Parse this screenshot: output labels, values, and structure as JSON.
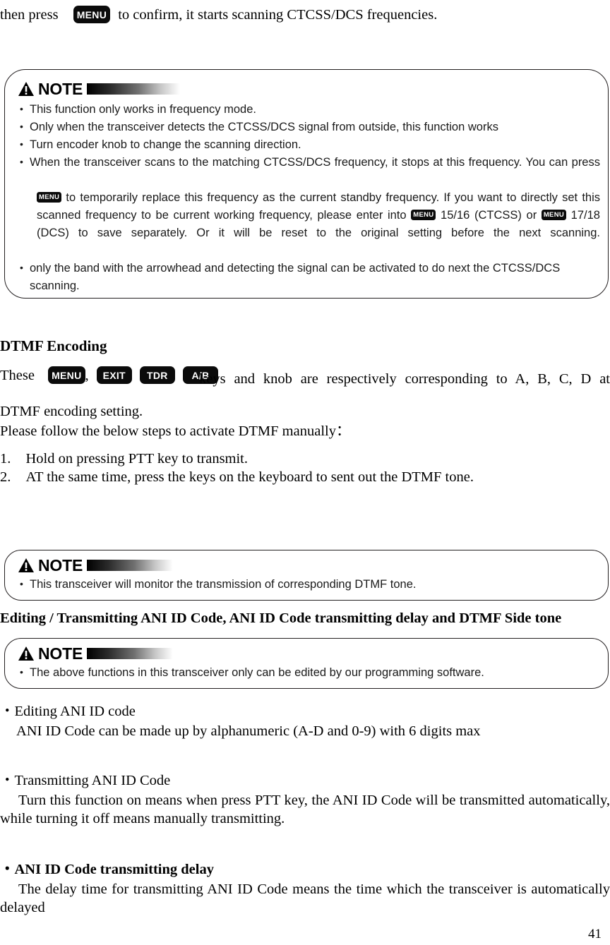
{
  "document": {
    "page_number": "41"
  },
  "intro": {
    "before_key": "then press",
    "key_label": "MENU",
    "after_key": "to confirm, it starts scanning CTCSS/DCS frequencies."
  },
  "note1": {
    "title": "NOTE",
    "icon": "warning-triangle-icon",
    "items": [
      "This function only works in frequency mode.",
      "Only when the transceiver detects the CTCSS/DCS signal from outside, this function works",
      "Turn encoder knob to change the scanning direction."
    ],
    "item4": {
      "part1": "When the transceiver scans to the matching CTCSS/DCS frequency, it stops at this frequency. You can press",
      "key1": "MENU",
      "part2": "to temporarily replace this frequency as the current standby frequency. If you want to directly set this scanned frequency to be current working frequency, please enter into",
      "key2": "MENU",
      "part3": "15/16 (CTCSS) or",
      "key3": "MENU",
      "part4": "17/18 (DCS) to save separately. Or it will be reset to the original setting before the next scanning."
    },
    "item5": "only the band with the arrowhead and detecting the signal can be activated to do next the CTCSS/DCS scanning."
  },
  "dtmf_encoding": {
    "heading": "DTMF Encoding",
    "line_start": "These",
    "keys": [
      "MENU",
      "EXIT",
      "TDR",
      "A/B"
    ],
    "key_separator": ",",
    "line_end": "keys and knob are respectively corresponding to A, B, C, D at DTMF encoding setting.",
    "instruction": "Please follow the below steps to activate DTMF manually：",
    "steps": [
      {
        "num": "1.",
        "text": "Hold on pressing PTT key to transmit."
      },
      {
        "num": "2.",
        "text": "AT the same time, press the keys on the keyboard to sent out the DTMF tone."
      }
    ]
  },
  "note2": {
    "title": "NOTE",
    "icon": "warning-triangle-icon",
    "items": [
      "This transceiver will monitor the transmission of corresponding DTMF tone."
    ]
  },
  "ani_section": {
    "heading": "Editing / Transmitting ANI ID Code, ANI ID Code transmitting delay and DTMF Side tone"
  },
  "note3": {
    "title": "NOTE",
    "icon": "warning-triangle-icon",
    "items": [
      "The above functions in this transceiver only can be edited by our programming software."
    ]
  },
  "ani_blocks": [
    {
      "bullet_label": "Editing ANI ID code",
      "bold": false,
      "body": "ANI ID Code can be made up by alphanumeric (A-D and 0-9) with 6 digits max"
    },
    {
      "bullet_label": "Transmitting ANI ID Code",
      "bold": false,
      "body": "Turn this function on means when press PTT key, the ANI ID Code will be transmitted automatically, while turning it off means manually transmitting."
    },
    {
      "bullet_label": "ANI ID Code transmitting delay",
      "bold": true,
      "body": "The delay time for transmitting ANI ID Code means the time which the transceiver is automatically delayed"
    }
  ]
}
